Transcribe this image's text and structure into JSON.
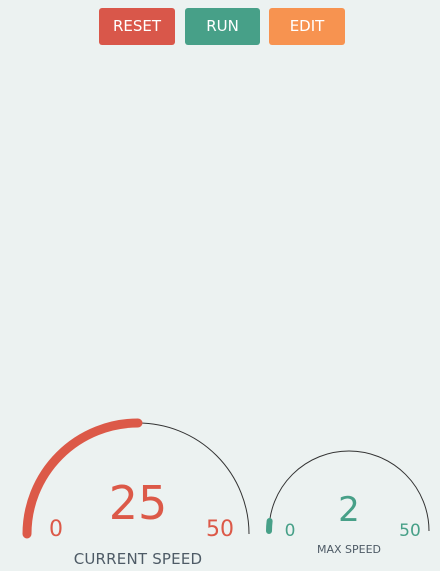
{
  "toolbar": {
    "reset_label": "RESET",
    "run_label": "RUN",
    "edit_label": "EDIT"
  },
  "colors": {
    "background": "#ecf2f1",
    "reset": "#d9574a",
    "run": "#47a088",
    "edit": "#f79350",
    "current_gauge": "#dc5948",
    "max_gauge": "#47a088",
    "gauge_track": "#333333",
    "label_text": "#4e5b66"
  },
  "gauges": {
    "current_speed": {
      "label": "CURRENT SPEED",
      "value": "25",
      "min_label": "0",
      "max_label": "50",
      "fill_fraction": 0.5
    },
    "max_speed": {
      "label": "MAX SPEED",
      "value": "2",
      "min_label": "0",
      "max_label": "50",
      "fill_fraction": 0.04
    }
  }
}
